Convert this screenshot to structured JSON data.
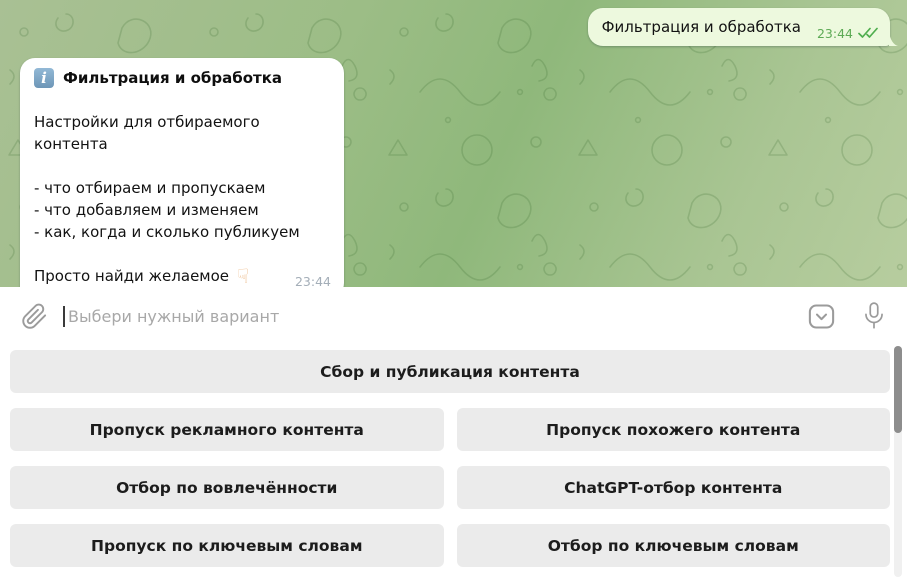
{
  "chat": {
    "outgoing_message": {
      "text": "Фильтрация и обработка",
      "time": "23:44",
      "status_icon": "double-check-icon"
    },
    "incoming_message": {
      "title_emoji": "i",
      "title": "Фильтрация и обработка",
      "body_lines": [
        "Настройки для отбираемого контента",
        "",
        "- что отбираем и пропускаем",
        "- что добавляем и изменяем",
        "- как, когда и сколько публикуем",
        ""
      ],
      "footer_text": "Просто найди желаемое",
      "footer_emoji": "☟",
      "time": "23:44"
    }
  },
  "composer": {
    "placeholder": "Выбери нужный вариант",
    "icons": [
      "paperclip-icon",
      "keyboard-toggle-icon",
      "microphone-icon"
    ]
  },
  "keyboard": {
    "rows": [
      [
        "Сбор и публикация контента"
      ],
      [
        "Пропуск рекламного контента",
        "Пропуск похожего контента"
      ],
      [
        "Отбор по вовлечённости",
        "ChatGPT-отбор контента"
      ],
      [
        "Пропуск по ключевым словам",
        "Отбор по ключевым словам"
      ]
    ]
  },
  "colors": {
    "outgoing_bubble": "#edf9de",
    "incoming_bubble": "#ffffff",
    "accent_green": "#5daa55",
    "chat_bg_dark": "#8fb87b",
    "chat_bg_light": "#b7cd9f",
    "button_bg": "#ebebeb",
    "scrollbar_thumb": "#8d8d8d"
  }
}
